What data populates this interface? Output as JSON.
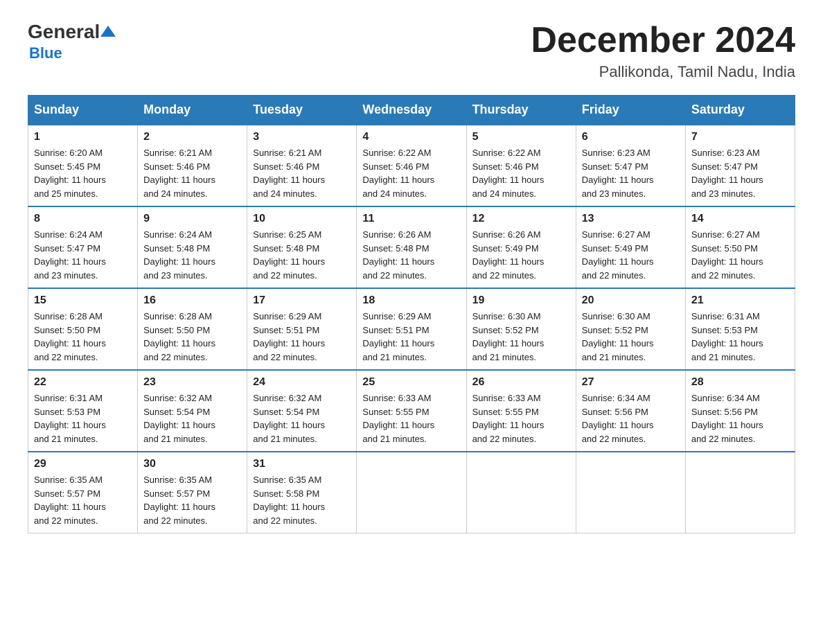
{
  "logo": {
    "general": "General",
    "blue": "Blue"
  },
  "header": {
    "month_year": "December 2024",
    "location": "Pallikonda, Tamil Nadu, India"
  },
  "days_of_week": [
    "Sunday",
    "Monday",
    "Tuesday",
    "Wednesday",
    "Thursday",
    "Friday",
    "Saturday"
  ],
  "weeks": [
    [
      {
        "day": "1",
        "sunrise": "6:20 AM",
        "sunset": "5:45 PM",
        "daylight": "11 hours and 25 minutes."
      },
      {
        "day": "2",
        "sunrise": "6:21 AM",
        "sunset": "5:46 PM",
        "daylight": "11 hours and 24 minutes."
      },
      {
        "day": "3",
        "sunrise": "6:21 AM",
        "sunset": "5:46 PM",
        "daylight": "11 hours and 24 minutes."
      },
      {
        "day": "4",
        "sunrise": "6:22 AM",
        "sunset": "5:46 PM",
        "daylight": "11 hours and 24 minutes."
      },
      {
        "day": "5",
        "sunrise": "6:22 AM",
        "sunset": "5:46 PM",
        "daylight": "11 hours and 24 minutes."
      },
      {
        "day": "6",
        "sunrise": "6:23 AM",
        "sunset": "5:47 PM",
        "daylight": "11 hours and 23 minutes."
      },
      {
        "day": "7",
        "sunrise": "6:23 AM",
        "sunset": "5:47 PM",
        "daylight": "11 hours and 23 minutes."
      }
    ],
    [
      {
        "day": "8",
        "sunrise": "6:24 AM",
        "sunset": "5:47 PM",
        "daylight": "11 hours and 23 minutes."
      },
      {
        "day": "9",
        "sunrise": "6:24 AM",
        "sunset": "5:48 PM",
        "daylight": "11 hours and 23 minutes."
      },
      {
        "day": "10",
        "sunrise": "6:25 AM",
        "sunset": "5:48 PM",
        "daylight": "11 hours and 22 minutes."
      },
      {
        "day": "11",
        "sunrise": "6:26 AM",
        "sunset": "5:48 PM",
        "daylight": "11 hours and 22 minutes."
      },
      {
        "day": "12",
        "sunrise": "6:26 AM",
        "sunset": "5:49 PM",
        "daylight": "11 hours and 22 minutes."
      },
      {
        "day": "13",
        "sunrise": "6:27 AM",
        "sunset": "5:49 PM",
        "daylight": "11 hours and 22 minutes."
      },
      {
        "day": "14",
        "sunrise": "6:27 AM",
        "sunset": "5:50 PM",
        "daylight": "11 hours and 22 minutes."
      }
    ],
    [
      {
        "day": "15",
        "sunrise": "6:28 AM",
        "sunset": "5:50 PM",
        "daylight": "11 hours and 22 minutes."
      },
      {
        "day": "16",
        "sunrise": "6:28 AM",
        "sunset": "5:50 PM",
        "daylight": "11 hours and 22 minutes."
      },
      {
        "day": "17",
        "sunrise": "6:29 AM",
        "sunset": "5:51 PM",
        "daylight": "11 hours and 22 minutes."
      },
      {
        "day": "18",
        "sunrise": "6:29 AM",
        "sunset": "5:51 PM",
        "daylight": "11 hours and 21 minutes."
      },
      {
        "day": "19",
        "sunrise": "6:30 AM",
        "sunset": "5:52 PM",
        "daylight": "11 hours and 21 minutes."
      },
      {
        "day": "20",
        "sunrise": "6:30 AM",
        "sunset": "5:52 PM",
        "daylight": "11 hours and 21 minutes."
      },
      {
        "day": "21",
        "sunrise": "6:31 AM",
        "sunset": "5:53 PM",
        "daylight": "11 hours and 21 minutes."
      }
    ],
    [
      {
        "day": "22",
        "sunrise": "6:31 AM",
        "sunset": "5:53 PM",
        "daylight": "11 hours and 21 minutes."
      },
      {
        "day": "23",
        "sunrise": "6:32 AM",
        "sunset": "5:54 PM",
        "daylight": "11 hours and 21 minutes."
      },
      {
        "day": "24",
        "sunrise": "6:32 AM",
        "sunset": "5:54 PM",
        "daylight": "11 hours and 21 minutes."
      },
      {
        "day": "25",
        "sunrise": "6:33 AM",
        "sunset": "5:55 PM",
        "daylight": "11 hours and 21 minutes."
      },
      {
        "day": "26",
        "sunrise": "6:33 AM",
        "sunset": "5:55 PM",
        "daylight": "11 hours and 22 minutes."
      },
      {
        "day": "27",
        "sunrise": "6:34 AM",
        "sunset": "5:56 PM",
        "daylight": "11 hours and 22 minutes."
      },
      {
        "day": "28",
        "sunrise": "6:34 AM",
        "sunset": "5:56 PM",
        "daylight": "11 hours and 22 minutes."
      }
    ],
    [
      {
        "day": "29",
        "sunrise": "6:35 AM",
        "sunset": "5:57 PM",
        "daylight": "11 hours and 22 minutes."
      },
      {
        "day": "30",
        "sunrise": "6:35 AM",
        "sunset": "5:57 PM",
        "daylight": "11 hours and 22 minutes."
      },
      {
        "day": "31",
        "sunrise": "6:35 AM",
        "sunset": "5:58 PM",
        "daylight": "11 hours and 22 minutes."
      },
      null,
      null,
      null,
      null
    ]
  ],
  "labels": {
    "sunrise": "Sunrise:",
    "sunset": "Sunset:",
    "daylight": "Daylight:"
  }
}
